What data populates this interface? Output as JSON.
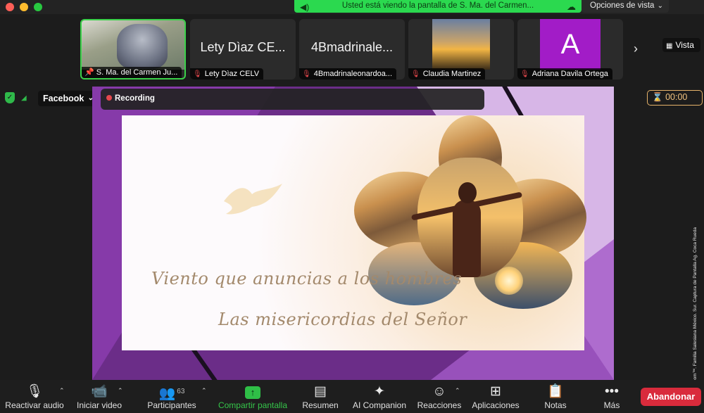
{
  "window": {
    "share_banner": "Usted está viendo la pantalla de S. Ma. del Carmen...",
    "view_options": "Opciones de vista",
    "vista_label": "Vista"
  },
  "thumbnails": [
    {
      "name": "S. Ma. del Carmen Ju...",
      "type": "camera",
      "active": true
    },
    {
      "name": "Lety Dìaz CELV",
      "big": "Lety Dìaz CE...",
      "type": "name"
    },
    {
      "name": "4Bmadrinaleonardoa...",
      "big": "4Bmadrinale...",
      "type": "name"
    },
    {
      "name": "Claudia Martinez",
      "type": "image"
    },
    {
      "name": "Adriana Davila Ortega",
      "avatar": "A",
      "type": "avatar"
    }
  ],
  "status": {
    "stream_label": "Facebook",
    "recording_label": "Recording",
    "timer": "00:00"
  },
  "slide": {
    "line1": "Viento que anuncias a los hombres",
    "line2": "Las misericordias del Señor"
  },
  "credit": "Cortesía © Zoom™. Familia Salesiana México. Sur. Captura de Pantalla Ag. Coca Rueda",
  "toolbar": {
    "mute": "Reactivar audio",
    "video": "Iniciar video",
    "participants": "Participantes",
    "participants_count": "63",
    "share": "Compartir pantalla",
    "summary": "Resumen",
    "companion": "AI Companion",
    "reactions": "Reacciones",
    "apps": "Aplicaciones",
    "notes": "Notas",
    "more": "Más",
    "leave": "Abandonar"
  },
  "colors": {
    "share_green": "#2bd94f",
    "leave_red": "#d92b3c",
    "slide_purple": "#6b2d88"
  }
}
